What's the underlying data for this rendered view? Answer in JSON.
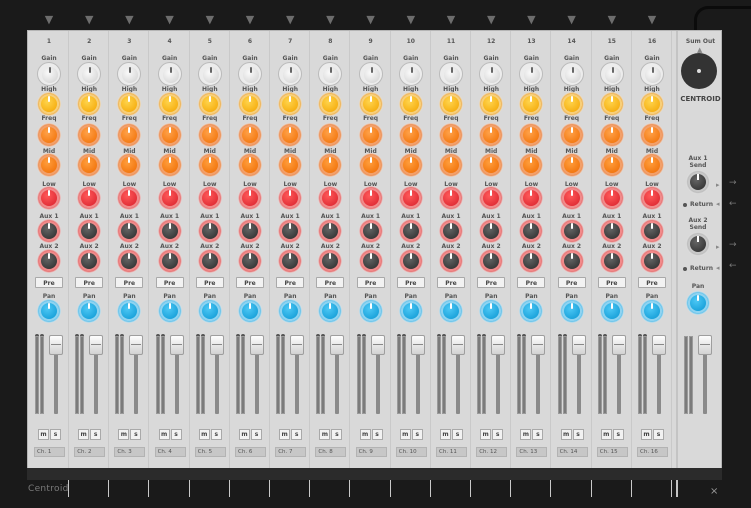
{
  "app": {
    "brand": "Centroid",
    "close_symbol": "×"
  },
  "channel_labels": {
    "gain": "Gain",
    "high": "High",
    "freq": "Freq",
    "mid": "Mid",
    "low": "Low",
    "aux1": "Aux 1",
    "aux2": "Aux 2",
    "pre": "Pre",
    "pan": "Pan",
    "mute": "m",
    "solo": "s"
  },
  "channels": [
    {
      "number": "1",
      "name": "Ch. 1",
      "fader": 0.85
    },
    {
      "number": "2",
      "name": "Ch. 2",
      "fader": 0.85
    },
    {
      "number": "3",
      "name": "Ch. 3",
      "fader": 0.85
    },
    {
      "number": "4",
      "name": "Ch. 4",
      "fader": 0.85
    },
    {
      "number": "5",
      "name": "Ch. 5",
      "fader": 0.85
    },
    {
      "number": "6",
      "name": "Ch. 6",
      "fader": 0.85
    },
    {
      "number": "7",
      "name": "Ch. 7",
      "fader": 0.85
    },
    {
      "number": "8",
      "name": "Ch. 8",
      "fader": 0.85
    },
    {
      "number": "9",
      "name": "Ch. 9",
      "fader": 0.85
    },
    {
      "number": "10",
      "name": "Ch. 10",
      "fader": 0.85
    },
    {
      "number": "11",
      "name": "Ch. 11",
      "fader": 0.85
    },
    {
      "number": "12",
      "name": "Ch. 12",
      "fader": 0.85
    },
    {
      "number": "13",
      "name": "Ch. 13",
      "fader": 0.85
    },
    {
      "number": "14",
      "name": "Ch. 14",
      "fader": 0.85
    },
    {
      "number": "15",
      "name": "Ch. 15",
      "fader": 0.85
    },
    {
      "number": "16",
      "name": "Ch. 16",
      "fader": 0.85
    }
  ],
  "master": {
    "sum_out": "Sum Out",
    "title": "CENTROID",
    "aux1_send": "Aux 1",
    "aux2_send": "Aux 2",
    "send": "Send",
    "return": "Return",
    "pan": "Pan",
    "fader": 0.85
  },
  "icons": {
    "input_arrow": "down-arrow-icon",
    "send_arrow": "right-arrow-icon",
    "return_arrow": "left-arrow-icon"
  },
  "colors": {
    "high": "#f3a400",
    "freq": "#f06d00",
    "mid": "#ee6a00",
    "low": "#d81f2a",
    "aux": "#2a2a2a",
    "pan": "#0a96d2"
  }
}
